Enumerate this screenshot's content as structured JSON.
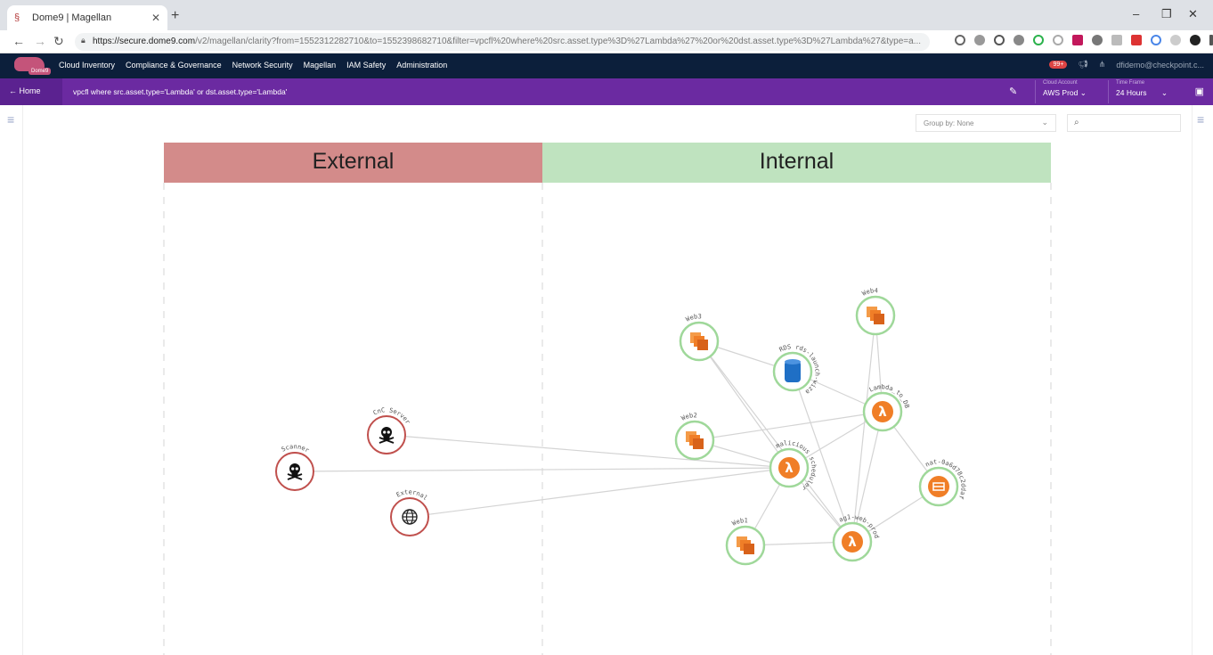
{
  "browser": {
    "tab_title": "Dome9 | Magellan",
    "url_host": "https://secure.dome9.com",
    "url_path": "/v2/magellan/clarity?from=1552312282710&to=1552398682710&filter=vpcfl%20where%20src.asset.type%3D%27Lambda%27%20or%20dst.asset.type%3D%27Lambda%27&type=a..."
  },
  "app_nav": {
    "logo_badge": "Dome9",
    "items": [
      "Cloud Inventory",
      "Compliance & Governance",
      "Network Security",
      "Magellan",
      "IAM Safety",
      "Administration"
    ],
    "notifications": "99+",
    "user": "dfidemo@checkpoint.c..."
  },
  "query_bar": {
    "home_label": "← Home",
    "query": "vpcfl where src.asset.type='Lambda' or dst.asset.type='Lambda'",
    "cloud_account_caption": "Cloud Account",
    "cloud_account_value": "AWS Prod",
    "time_frame_caption": "Time Frame",
    "time_frame_value": "24 Hours"
  },
  "toolbar": {
    "group_by": "Group by: None"
  },
  "zones": {
    "external": "External",
    "internal": "Internal"
  },
  "nodes": [
    {
      "id": "cnc",
      "label": "CnC Server",
      "icon": "skull-icon",
      "zone": "external"
    },
    {
      "id": "scanner",
      "label": "Scanner",
      "icon": "skull-icon",
      "zone": "external"
    },
    {
      "id": "external",
      "label": "External",
      "icon": "globe-icon",
      "zone": "external"
    },
    {
      "id": "web3",
      "label": "Web3",
      "icon": "ec2-instances-icon",
      "zone": "internal"
    },
    {
      "id": "web4",
      "label": "Web4",
      "icon": "ec2-instances-icon",
      "zone": "internal"
    },
    {
      "id": "rds",
      "label": "RDS rds-launch-wizard-1 (sen...)",
      "icon": "rds-database-icon",
      "zone": "internal"
    },
    {
      "id": "lambda_db",
      "label": "Lambda_to_DB",
      "icon": "lambda-icon",
      "zone": "internal"
    },
    {
      "id": "web2",
      "label": "Web2",
      "icon": "ec2-instances-icon",
      "zone": "internal"
    },
    {
      "id": "malicious",
      "label": "malicious scheduler",
      "icon": "lambda-icon",
      "zone": "internal"
    },
    {
      "id": "nat",
      "label": "nat-0a6d78c2ddaf",
      "icon": "nat-gateway-icon",
      "zone": "internal"
    },
    {
      "id": "web1",
      "label": "Web1",
      "icon": "ec2-instances-icon",
      "zone": "internal"
    },
    {
      "id": "ag1",
      "label": "ag1-web-prod",
      "icon": "lambda-icon",
      "zone": "internal"
    }
  ],
  "edges": [
    [
      "cnc",
      "malicious"
    ],
    [
      "scanner",
      "malicious"
    ],
    [
      "external",
      "malicious"
    ],
    [
      "web3",
      "rds"
    ],
    [
      "web3",
      "malicious"
    ],
    [
      "web3",
      "ag1"
    ],
    [
      "rds",
      "lambda_db"
    ],
    [
      "rds",
      "ag1"
    ],
    [
      "web4",
      "lambda_db"
    ],
    [
      "web4",
      "ag1"
    ],
    [
      "web2",
      "lambda_db"
    ],
    [
      "web2",
      "malicious"
    ],
    [
      "lambda_db",
      "malicious"
    ],
    [
      "lambda_db",
      "nat"
    ],
    [
      "lambda_db",
      "ag1"
    ],
    [
      "malicious",
      "ag1"
    ],
    [
      "malicious",
      "web1"
    ],
    [
      "web1",
      "ag1"
    ],
    [
      "ag1",
      "nat"
    ]
  ],
  "colors": {
    "external_ring": "#c0504d",
    "internal_ring": "#9fd89a",
    "aws_orange": "#f07e27",
    "rds_blue": "#1f6fc5",
    "edge": "#d4d4d4"
  }
}
